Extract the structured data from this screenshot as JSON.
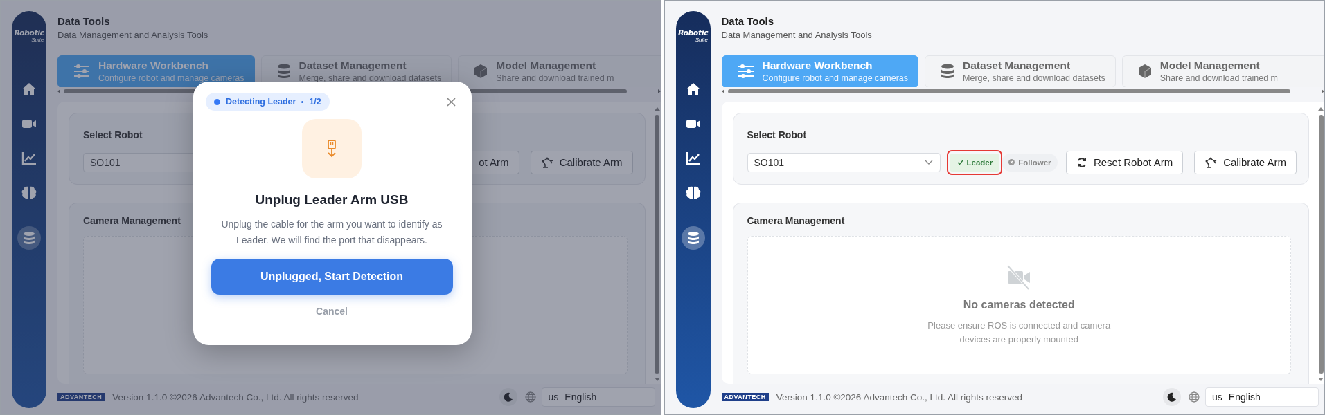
{
  "panels": [
    {
      "sidebar": {
        "logo": {
          "line1": "Robotic",
          "line2": "Suite"
        },
        "items": [
          {
            "kind": "home",
            "selected": false
          },
          {
            "kind": "video",
            "selected": false
          },
          {
            "kind": "chart",
            "selected": false
          },
          {
            "kind": "brain",
            "selected": false
          },
          {
            "kind": "database",
            "selected": true
          }
        ]
      },
      "header": {
        "title": "Data Tools",
        "subtitle": "Data Management and Analysis Tools"
      },
      "tabs": [
        {
          "kind": "sliders",
          "title": "Hardware Workbench",
          "subtitle": "Configure robot and manage cameras",
          "selected": true
        },
        {
          "kind": "database",
          "title": "Dataset Management",
          "subtitle": "Merge, share and download datasets",
          "selected": false
        },
        {
          "kind": "cube",
          "title": "Model Management",
          "subtitle": "Share and download trained m",
          "selected": false
        }
      ],
      "robot": {
        "label": "Select Robot",
        "value": "SO101",
        "buttons": [
          {
            "label": "ot Arm"
          },
          {
            "kind": "calibrate",
            "label": "Calibrate Arm"
          }
        ]
      },
      "cameras": {
        "title": "Camera Management"
      },
      "footer": {
        "brand": "ADVANTECH",
        "version": "Version 1.1.0 ©2026 Advantech Co., Ltd. All rights reserved",
        "language": {
          "prefix": "us",
          "value": "English"
        }
      },
      "modal": {
        "badge": "Detecting Leader",
        "step": "1/2",
        "title": "Unplug Leader Arm USB",
        "text": "Unplug the cable for the arm you want to identify as Leader. We will find the port that disappears.",
        "primary": "Unplugged, Start Detection",
        "cancel": "Cancel"
      }
    },
    {
      "sidebar": {
        "logo": {
          "line1": "Robotic",
          "line2": "Suite"
        },
        "items": [
          {
            "kind": "home",
            "selected": false
          },
          {
            "kind": "video",
            "selected": false
          },
          {
            "kind": "chart",
            "selected": false
          },
          {
            "kind": "brain",
            "selected": false
          },
          {
            "kind": "database",
            "selected": true
          }
        ]
      },
      "header": {
        "title": "Data Tools",
        "subtitle": "Data Management and Analysis Tools"
      },
      "tabs": [
        {
          "kind": "sliders",
          "title": "Hardware Workbench",
          "subtitle": "Configure robot and manage cameras",
          "selected": true
        },
        {
          "kind": "database",
          "title": "Dataset Management",
          "subtitle": "Merge, share and download datasets",
          "selected": false
        },
        {
          "kind": "cube",
          "title": "Model Management",
          "subtitle": "Share and download trained m",
          "selected": false
        }
      ],
      "robot": {
        "label": "Select Robot",
        "value": "SO101",
        "roles": [
          {
            "label": "Leader",
            "selected": true,
            "highlighted": true
          },
          {
            "label": "Follower",
            "selected": false,
            "highlighted": false
          }
        ],
        "buttons": [
          {
            "kind": "reset",
            "label": "Reset Robot Arm"
          },
          {
            "kind": "calibrate",
            "label": "Calibrate Arm"
          }
        ]
      },
      "cameras": {
        "title": "Camera Management",
        "empty_title": "No cameras detected",
        "empty_text": "Please ensure ROS is connected and camera devices are properly mounted"
      },
      "footer": {
        "brand": "ADVANTECH",
        "version": "Version 1.1.0 ©2026 Advantech Co., Ltd. All rights reserved",
        "language": {
          "prefix": "us",
          "value": "English"
        }
      }
    }
  ]
}
